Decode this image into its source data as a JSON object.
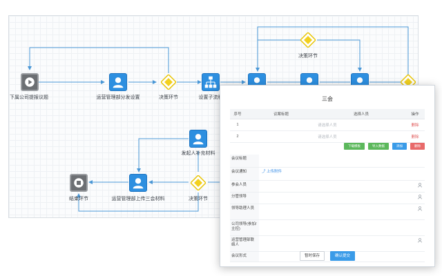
{
  "flow": {
    "node_labels": {
      "start": "下属公司提报议题",
      "ops_set": "运营管理部分发设置",
      "decision_1": "决策环节",
      "subflow": "设置子流程",
      "decision_top": "决策环节",
      "initiator": "发起人补充材料",
      "decision_2": "决策环节",
      "ops_upload": "运营管理部上传三会材料",
      "end": "结束环节"
    }
  },
  "dialog": {
    "title": "三会",
    "table": {
      "headers": [
        "序号",
        "议案标题",
        "选择人员",
        "操作"
      ],
      "rows": [
        {
          "no": "1",
          "title": "",
          "person_placeholder": "请选择人员",
          "action": "删除"
        },
        {
          "no": "2",
          "title": "",
          "person_placeholder": "请选择人员",
          "action": "删除"
        }
      ]
    },
    "buttons": {
      "download": "下载模板",
      "import": "导入数据",
      "add": "添加",
      "delete": "删除"
    },
    "form": {
      "meeting_title": "会议标题",
      "meeting_notice": "会议通知",
      "upload_link": "上传附件",
      "participants": "参会人员",
      "leader": "分管领导",
      "leader_staff": "领导助理人员",
      "company_leader": "公司领导(参加/主控)",
      "ops_contact": "运营管理部联络人",
      "meeting_form": "会议形式"
    },
    "footer": {
      "save": "暂时保存",
      "submit": "确认提交"
    }
  },
  "colors": {
    "accent": "#2d8fe0",
    "decision": "#f2d01f",
    "wire": "#4a97d6",
    "delete": "#e05a5a",
    "green": "#5cb85c"
  }
}
